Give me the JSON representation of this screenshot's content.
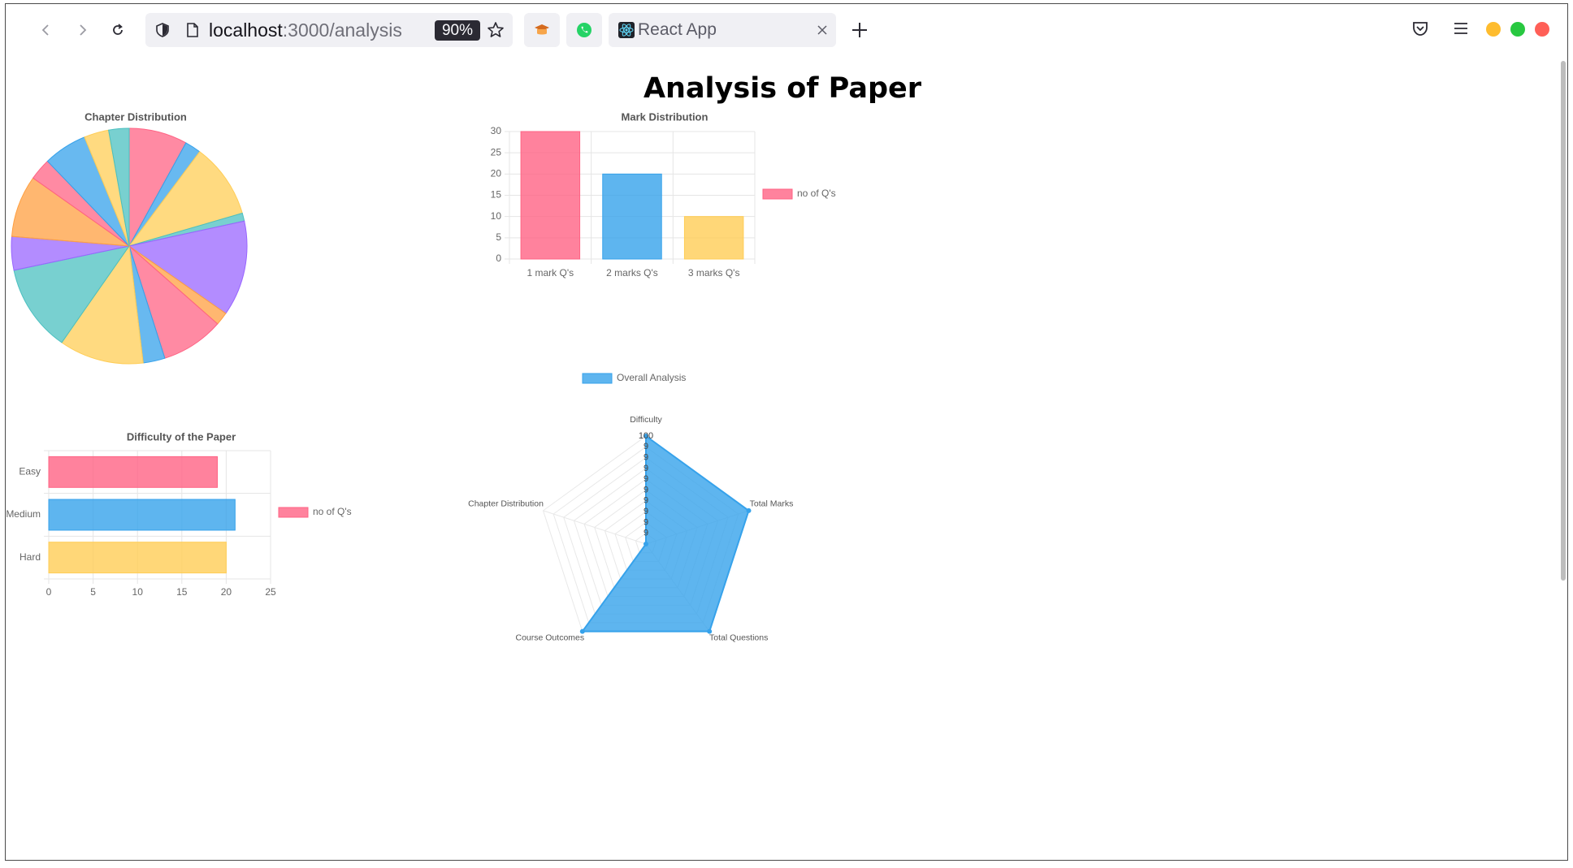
{
  "browser": {
    "url_host": "localhost",
    "url_path": ":3000/analysis",
    "zoom": "90%",
    "tab_title": "React App",
    "icons": [
      "back-icon",
      "forward-icon",
      "reload-icon",
      "shield-icon",
      "page-icon",
      "star-icon",
      "extension-icon",
      "whatsapp-icon",
      "react-icon",
      "close-icon",
      "plus-icon",
      "pocket-icon",
      "menu-icon"
    ],
    "traffic_colors": [
      "#febc2e",
      "#28c840",
      "#ff5f57"
    ]
  },
  "page": {
    "title": "Analysis of Paper"
  },
  "colors": {
    "red": "#ff6384",
    "blue": "#36a2eb",
    "yellow": "#ffcd56",
    "teal": "#4bc0c0",
    "purple": "#9966ff",
    "orange": "#ff9f40"
  },
  "chart_data": [
    {
      "type": "pie",
      "title": "Chapter Distribution",
      "slice_colors": [
        "#ff6384",
        "#36a2eb",
        "#ffcd56",
        "#4bc0c0",
        "#9966ff",
        "#ff9f40",
        "#ff6384",
        "#36a2eb",
        "#ffcd56",
        "#4bc0c0",
        "#9966ff",
        "#ff9f40",
        "#ff6384",
        "#36a2eb",
        "#ffcd56",
        "#4bc0c0"
      ],
      "values": [
        8.0,
        2.2,
        10.3,
        1.1,
        13.1,
        1.8,
        8.6,
        3.0,
        11.6,
        12.0,
        4.6,
        8.5,
        3.0,
        6.0,
        3.4,
        2.8
      ]
    },
    {
      "type": "bar",
      "title": "Mark Distribution",
      "categories": [
        "1 mark Q's",
        "2 marks Q's",
        "3 marks Q's"
      ],
      "values": [
        30,
        20,
        10
      ],
      "bar_colors": [
        "#ff6384",
        "#36a2eb",
        "#ffcd56"
      ],
      "legend": "no of Q's",
      "legend_position": "right",
      "ylim": [
        0,
        30
      ],
      "yticks": [
        "0",
        "5",
        "10",
        "15",
        "20",
        "25",
        "30"
      ]
    },
    {
      "type": "bar",
      "orientation": "horizontal",
      "title": "Difficulty of the Paper",
      "categories": [
        "Easy",
        "Medium",
        "Hard"
      ],
      "values": [
        19,
        21,
        20
      ],
      "bar_colors": [
        "#ff6384",
        "#36a2eb",
        "#ffcd56"
      ],
      "legend": "no of Q's",
      "legend_position": "right",
      "xlim": [
        0,
        25
      ],
      "xticks": [
        "0",
        "5",
        "10",
        "15",
        "20",
        "25"
      ]
    },
    {
      "type": "radar",
      "legend": "Overall Analysis",
      "legend_position": "top",
      "axes": [
        "Difficulty",
        "Total Marks",
        "Total Questions",
        "Course Outcomes",
        "Chapter Distribution"
      ],
      "values": [
        100,
        100,
        100,
        100,
        90
      ],
      "rlim": [
        90,
        100
      ],
      "rticks": [
        "9",
        "9",
        "9",
        "9",
        "9",
        "9",
        "9",
        "9",
        "9",
        "100"
      ],
      "color": "#36a2eb"
    }
  ]
}
